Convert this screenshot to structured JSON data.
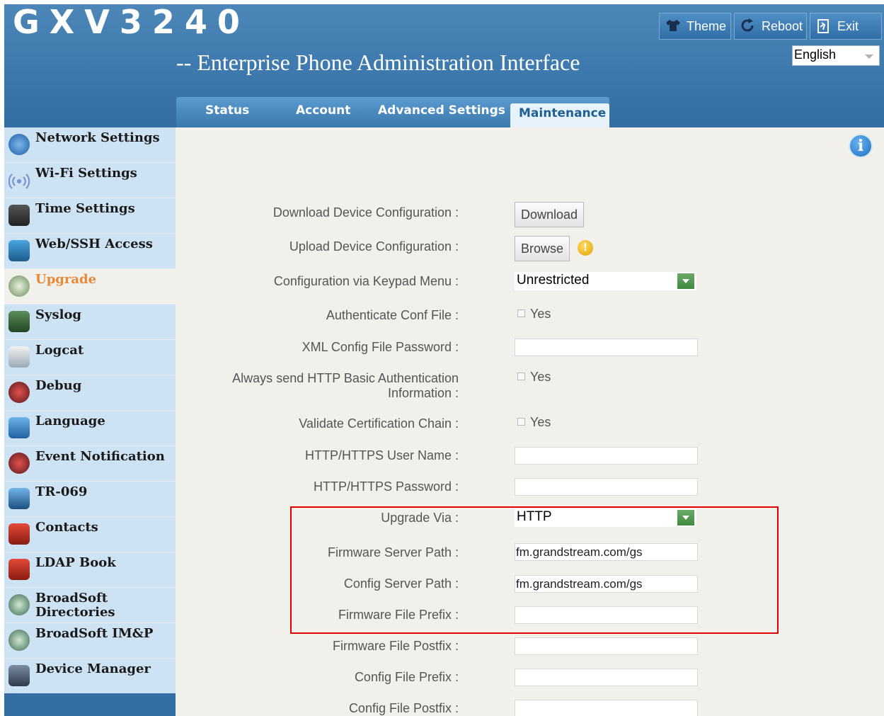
{
  "header": {
    "logo": "GXV3240",
    "subtitle": "-- Enterprise Phone Administration Interface",
    "buttons": {
      "theme": "Theme",
      "reboot": "Reboot",
      "exit": "Exit"
    },
    "language": "English"
  },
  "tabs": {
    "status": "Status",
    "account": "Account",
    "advanced": "Advanced Settings",
    "maintenance": "Maintenance"
  },
  "sidebar": {
    "items": [
      {
        "label": "Network Settings",
        "icon": "network-icon"
      },
      {
        "label": "Wi-Fi Settings",
        "icon": "wifi-icon"
      },
      {
        "label": "Time Settings",
        "icon": "clock-icon"
      },
      {
        "label": "Web/SSH Access",
        "icon": "monitor-icon"
      },
      {
        "label": "Upgrade",
        "icon": "upgrade-icon",
        "active": true
      },
      {
        "label": "Syslog",
        "icon": "syslog-icon"
      },
      {
        "label": "Logcat",
        "icon": "logcat-icon"
      },
      {
        "label": "Debug",
        "icon": "bug-icon"
      },
      {
        "label": "Language",
        "icon": "language-icon"
      },
      {
        "label": "Event Notification",
        "icon": "bell-icon"
      },
      {
        "label": "TR-069",
        "icon": "tr069-icon"
      },
      {
        "label": "Contacts",
        "icon": "contacts-icon"
      },
      {
        "label": "LDAP Book",
        "icon": "ldap-icon"
      },
      {
        "label": "BroadSoft Directories",
        "icon": "broadsoft-icon"
      },
      {
        "label": "BroadSoft IM&P",
        "icon": "broadsoft-icon"
      },
      {
        "label": "Device Manager",
        "icon": "device-manager-icon"
      }
    ]
  },
  "form": {
    "download_config": {
      "label": "Download Device Configuration :",
      "button": "Download"
    },
    "upload_config": {
      "label": "Upload Device Configuration :",
      "button": "Browse"
    },
    "keypad_menu": {
      "label": "Configuration via Keypad Menu :",
      "value": "Unrestricted"
    },
    "auth_conf": {
      "label": "Authenticate Conf File :",
      "option": "Yes"
    },
    "xml_password": {
      "label": "XML Config File Password :",
      "value": ""
    },
    "http_basic_auth": {
      "label": "Always send HTTP Basic Authentication Information :",
      "option": "Yes"
    },
    "validate_chain": {
      "label": "Validate Certification Chain :",
      "option": "Yes"
    },
    "http_user": {
      "label": "HTTP/HTTPS User Name :",
      "value": ""
    },
    "http_password": {
      "label": "HTTP/HTTPS Password :",
      "value": ""
    },
    "upgrade_via": {
      "label": "Upgrade Via :",
      "value": "HTTP"
    },
    "fw_server_path": {
      "label": "Firmware Server Path :",
      "value": "fm.grandstream.com/gs"
    },
    "cfg_server_path": {
      "label": "Config Server Path :",
      "value": "fm.grandstream.com/gs"
    },
    "fw_prefix": {
      "label": "Firmware File Prefix :",
      "value": ""
    },
    "fw_postfix": {
      "label": "Firmware File Postfix :",
      "value": ""
    },
    "cfg_prefix": {
      "label": "Config File Prefix :",
      "value": ""
    },
    "cfg_postfix": {
      "label": "Config File Postfix :",
      "value": ""
    }
  },
  "colors": {
    "header_blue": "#3d79ad",
    "sidebar_bg": "#cde2f3",
    "active_orange": "#e8893a",
    "highlight_red": "#e00000"
  }
}
